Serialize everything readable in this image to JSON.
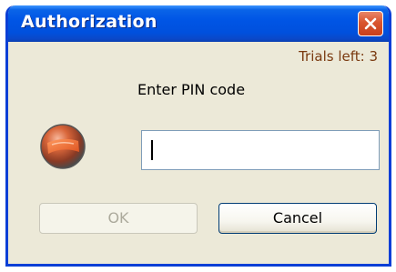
{
  "window": {
    "title": "Authorization",
    "close_icon": "close-x-icon"
  },
  "dialog": {
    "trials_text": "Trials left: 3",
    "pin_label": "Enter PIN code",
    "pin_value": "",
    "icon": "lock-orb-icon"
  },
  "buttons": {
    "ok_label": "OK",
    "ok_enabled": false,
    "cancel_label": "Cancel"
  },
  "colors": {
    "titlebar": "#0055e5",
    "window_border": "#0a3fd6",
    "close_button": "#d9552f",
    "trials_text": "#7a3a10",
    "dialog_bg": "#ece9d8"
  }
}
